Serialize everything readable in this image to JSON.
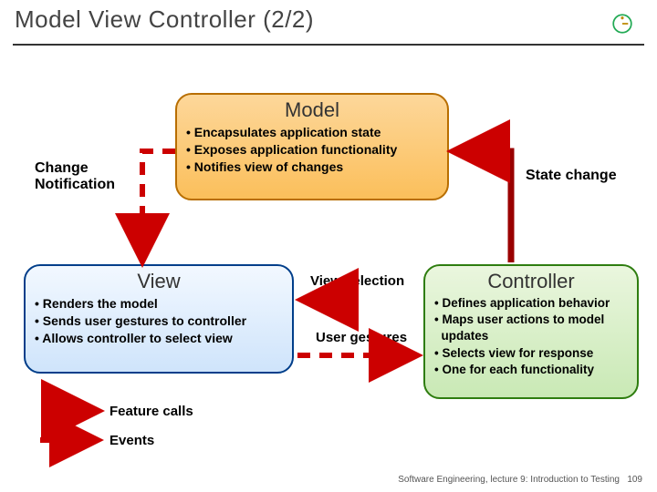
{
  "title": "Model View Controller (2/2)",
  "model": {
    "title": "Model",
    "b1": "• Encapsulates application state",
    "b2": "• Exposes application functionality",
    "b3": "• Notifies view of changes"
  },
  "view": {
    "title": "View",
    "b1": "• Renders the model",
    "b2": "• Sends user gestures to controller",
    "b3": "• Allows controller to select view"
  },
  "controller": {
    "title": "Controller",
    "b1": "• Defines application behavior",
    "b2": "• Maps user actions to model",
    "b2b": "  updates",
    "b3": "• Selects view for response",
    "b4": "• One for each functionality"
  },
  "labels": {
    "change_notification": "Change\nNotification",
    "state_change": "State change",
    "view_selection": "View selection",
    "user_gestures": "User gestures"
  },
  "legend": {
    "feature_calls": "Feature calls",
    "events": "Events"
  },
  "footer": {
    "text": "Software Engineering, lecture 9: Introduction to Testing",
    "page": "109"
  },
  "colors": {
    "model_fill": "#FCC76A",
    "model_stroke": "#B86E00",
    "view_fill": "#DDEEFF",
    "view_stroke": "#003E8A",
    "controller_fill": "#D8F0C8",
    "controller_stroke": "#2E7D0F",
    "solid_arrow": "#CC0000",
    "dashed_arrow": "#CC0000"
  }
}
